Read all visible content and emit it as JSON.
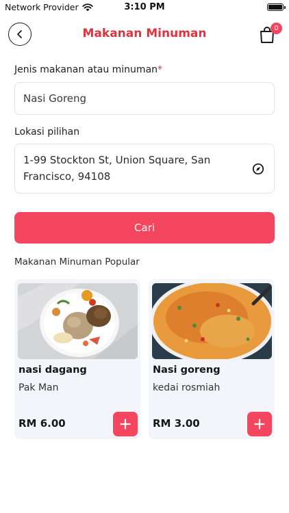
{
  "status_bar": {
    "carrier": "Network Provider",
    "time": "3:10 PM",
    "icons": [
      "wifi-icon",
      "battery-icon"
    ]
  },
  "header": {
    "title": "Makanan Minuman",
    "back_icon": "chevron-left-icon",
    "cart_icon": "shopping-bag-icon",
    "cart_count": "0"
  },
  "form": {
    "food_label": "Jenis makanan atau minuman",
    "required_mark": "*",
    "food_value": "Nasi Goreng",
    "location_label": "Lokasi pilihan",
    "location_value": "1-99 Stockton St, Union Square, San Francisco, 94108",
    "location_icon": "compass-icon",
    "search_label": "Cari"
  },
  "popular": {
    "title": "Makanan Minuman Popular",
    "items": [
      {
        "name": "nasi dagang",
        "vendor": "Pak Man",
        "price": "RM 6.00"
      },
      {
        "name": "Nasi goreng",
        "vendor": "kedai rosmiah",
        "price": "RM 3.00"
      }
    ]
  },
  "colors": {
    "accent": "#f4475f",
    "title": "#e0323f",
    "card_bg": "#f3f5fa"
  }
}
